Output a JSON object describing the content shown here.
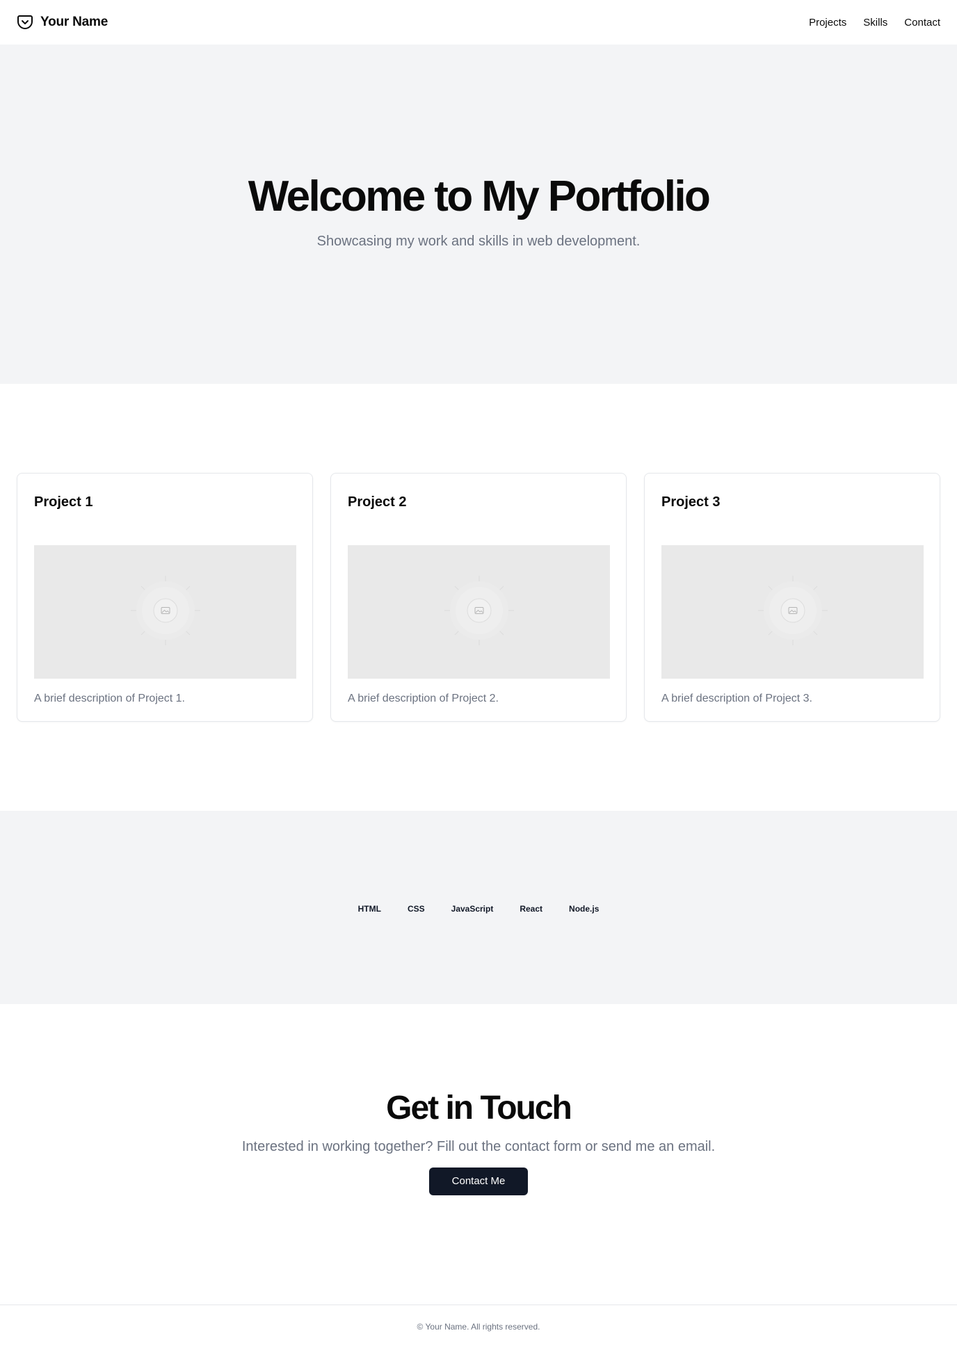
{
  "header": {
    "brand_icon": "pocket-icon",
    "brand_name": "Your Name",
    "nav": [
      "Projects",
      "Skills",
      "Contact"
    ]
  },
  "hero": {
    "title": "Welcome to My Portfolio",
    "subtitle": "Showcasing my work and skills in web development."
  },
  "projects": [
    {
      "title": "Project 1",
      "image_icon": "image-placeholder-icon",
      "description": "A brief description of Project 1."
    },
    {
      "title": "Project 2",
      "image_icon": "image-placeholder-icon",
      "description": "A brief description of Project 2."
    },
    {
      "title": "Project 3",
      "image_icon": "image-placeholder-icon",
      "description": "A brief description of Project 3."
    }
  ],
  "skills": [
    "HTML",
    "CSS",
    "JavaScript",
    "React",
    "Node.js"
  ],
  "contact": {
    "title": "Get in Touch",
    "text": "Interested in working together? Fill out the contact form or send me an email.",
    "button_label": "Contact Me"
  },
  "footer": {
    "text": "© Your Name. All rights reserved."
  },
  "colors": {
    "section_gray": "#f3f4f6",
    "muted_text": "#6b7280",
    "button_bg": "#111827",
    "border": "#e5e7eb"
  }
}
